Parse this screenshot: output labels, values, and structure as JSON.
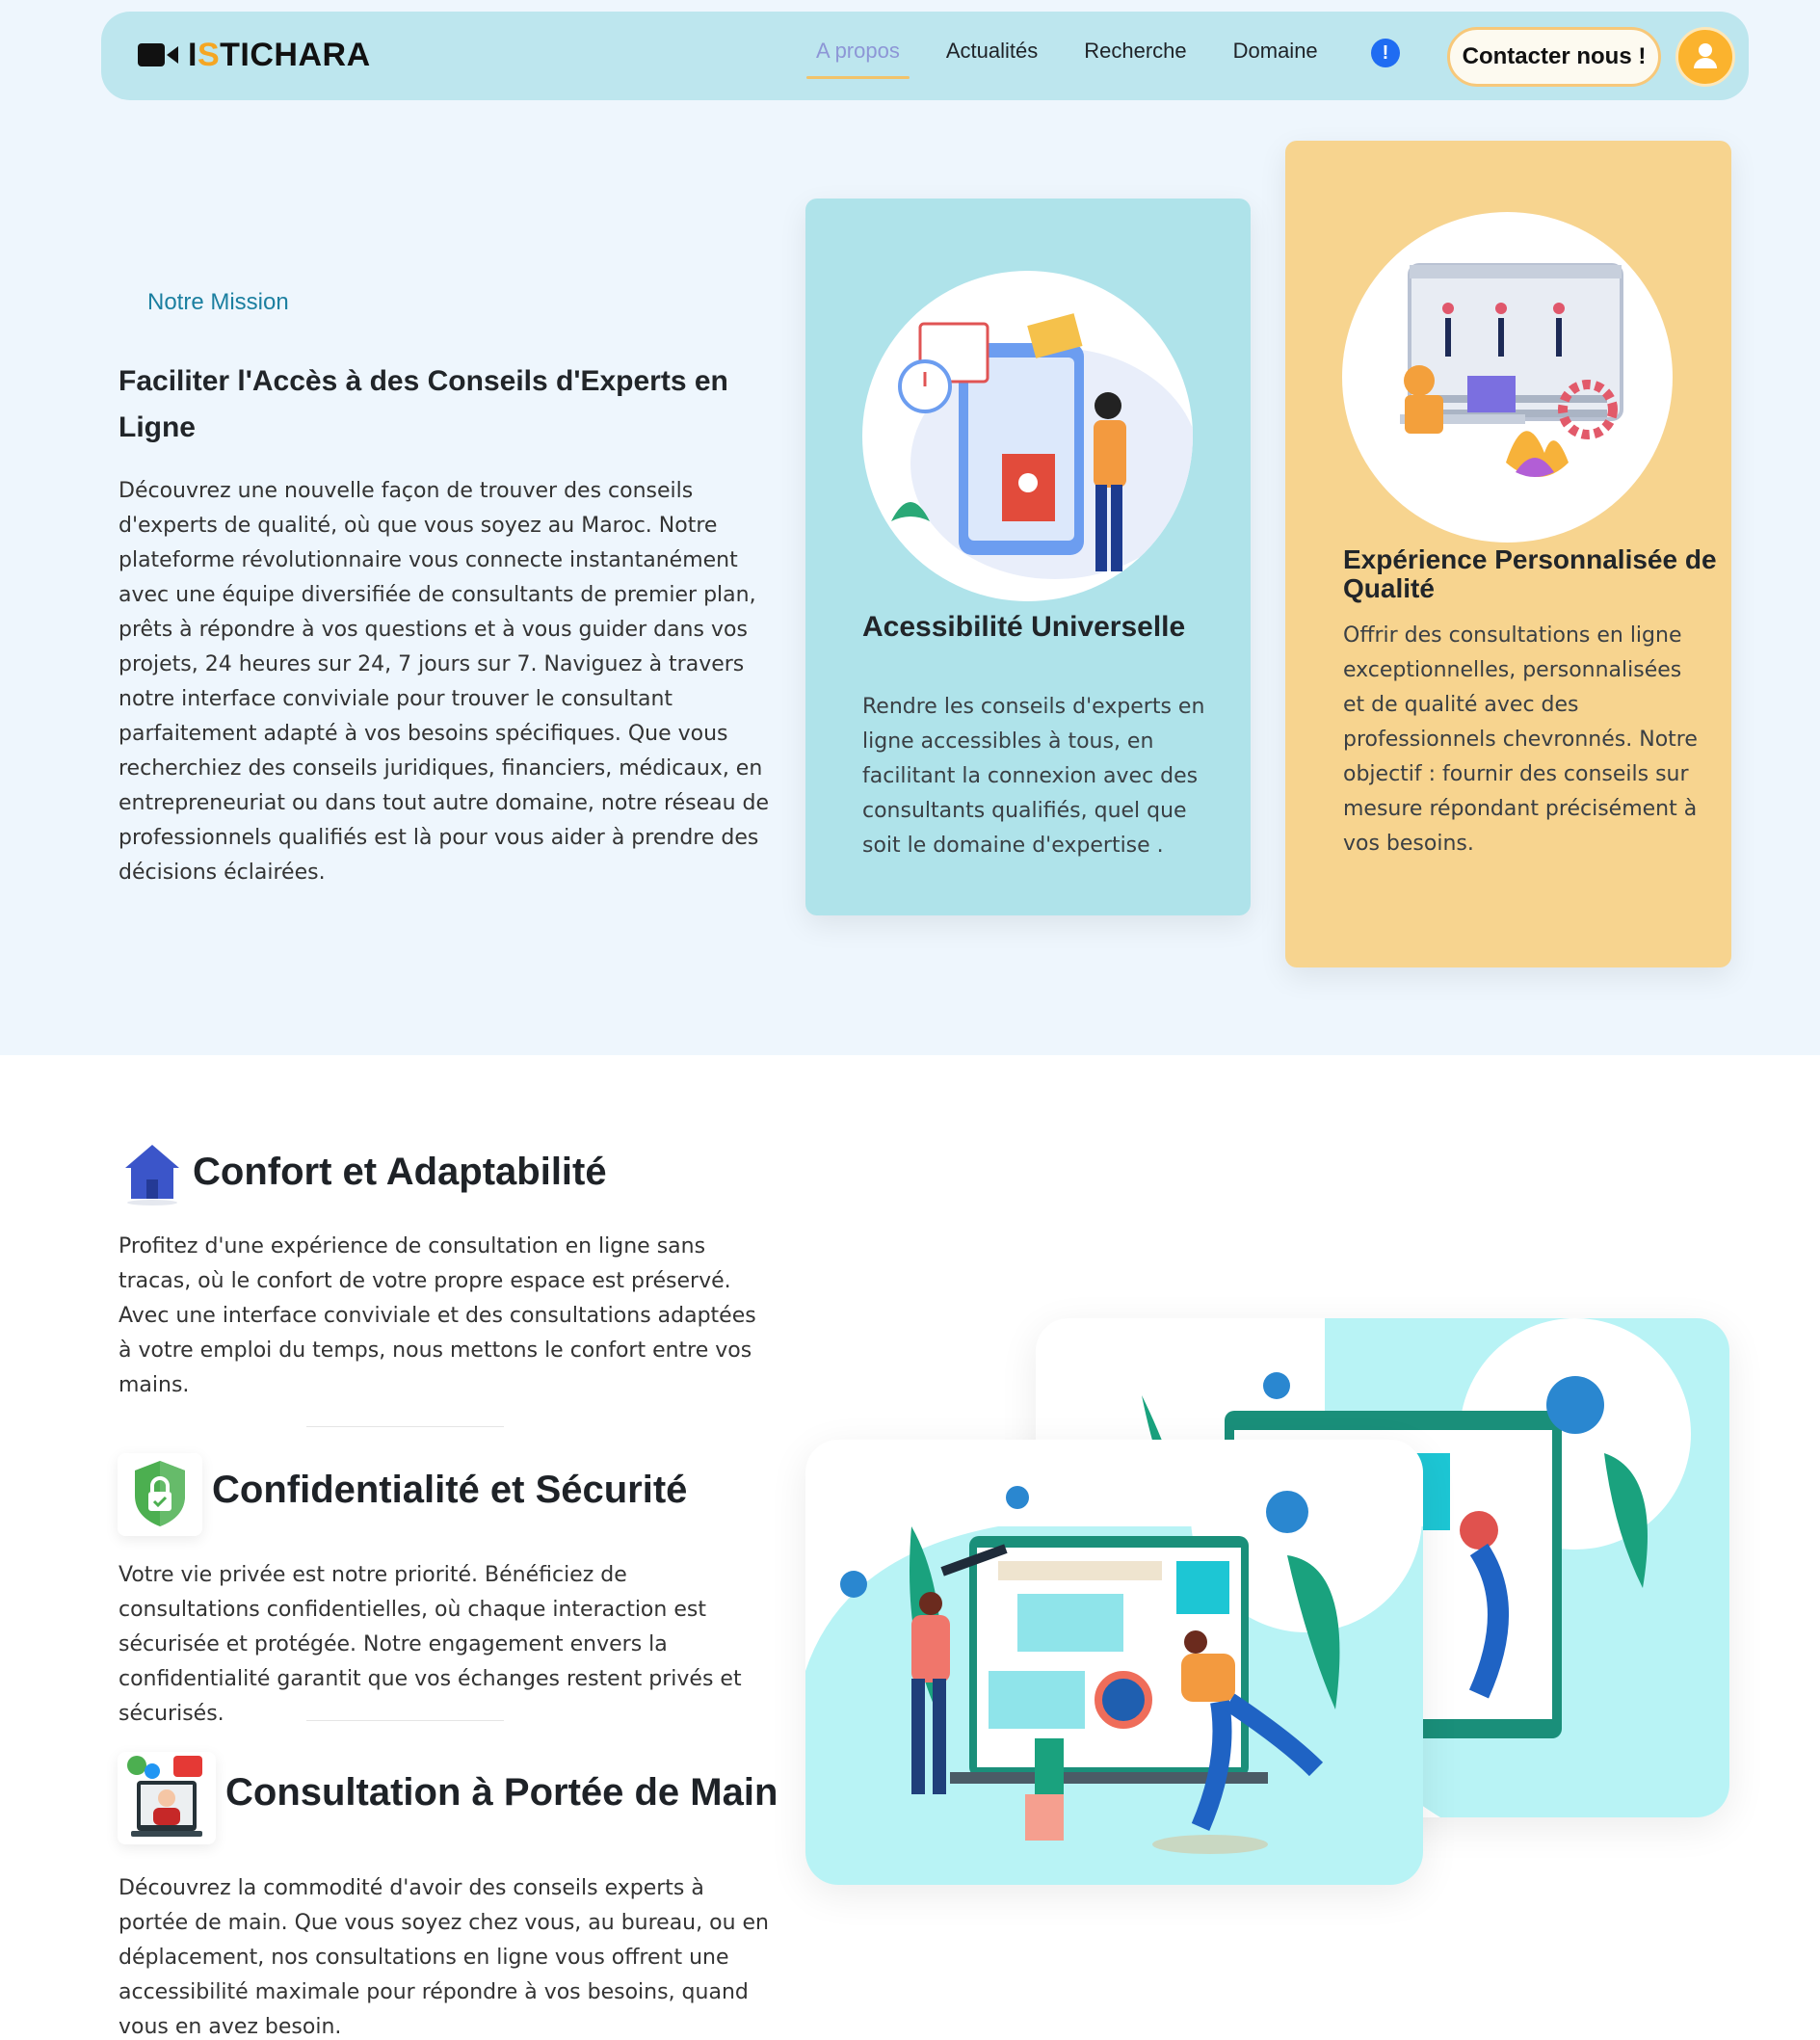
{
  "brand": {
    "prefix": "I",
    "accent": "S",
    "rest": "TICHARA"
  },
  "nav": {
    "links": [
      "A propos",
      "Actualités",
      "Recherche",
      "Domaine"
    ],
    "info_icon": "!",
    "contact_label": "Contacter nous !"
  },
  "mission": {
    "tag": "Notre Mission",
    "title": "Faciliter l'Accès à des Conseils d'Experts en Ligne",
    "text": "Découvrez une nouvelle façon de trouver des conseils d'experts de qualité, où que vous soyez au Maroc. Notre plateforme révolutionnaire vous connecte instantanément avec une équipe diversifiée de consultants de premier plan, prêts à répondre à vos questions et à vous guider dans vos projets, 24 heures sur 24, 7 jours sur 7. Naviguez à travers notre interface conviviale pour trouver le consultant parfaitement adapté à vos besoins spécifiques. Que vous recherchiez des conseils juridiques, financiers, médicaux, en entrepreneuriat ou dans tout autre domaine, notre réseau de professionnels qualifiés est là pour vous aider à prendre des décisions éclairées."
  },
  "cards": [
    {
      "title": "Acessibilité Universelle",
      "text": "Rendre les conseils d'experts en ligne accessibles à tous, en facilitant la connexion avec des consultants qualifiés, quel que soit le domaine d'expertise ."
    },
    {
      "title": "Expérience Personnalisée de Qualité",
      "text": "Offrir des consultations en ligne exceptionnelles, personnalisées et de qualité avec des professionnels chevronnés. Notre objectif : fournir des conseils sur mesure répondant précisément à vos besoins."
    }
  ],
  "features": [
    {
      "icon": "house-icon",
      "title": "Confort et Adaptabilité",
      "text": "Profitez d'une expérience de consultation en ligne sans tracas, où le confort de votre propre espace est préservé. Avec une interface conviviale et des consultations adaptées à votre emploi du temps, nous mettons le confort entre vos mains."
    },
    {
      "icon": "shield-lock-icon",
      "title": "Confidentialité et Sécurité",
      "text": "Votre vie privée est notre priorité. Bénéficiez de consultations confidentielles, où chaque interaction est sécurisée et protégée. Notre engagement envers la confidentialité garantit que vos échanges restent privés et sécurisés."
    },
    {
      "icon": "video-consultation-icon",
      "title": "Consultation à Portée de Main",
      "text": "Découvrez la commodité d'avoir des conseils experts à portée de main. Que vous soyez chez vous, au bureau, ou en déplacement, nos consultations en ligne vous offrent une accessibilité maximale pour répondre à vos besoins, quand vous en avez besoin."
    }
  ],
  "colors": {
    "navbar": "#bde6ee",
    "accent": "#f5a623",
    "card_blue": "#afe3ea",
    "card_yellow": "#f7d48f",
    "mission_tag": "#1b7fa0"
  }
}
